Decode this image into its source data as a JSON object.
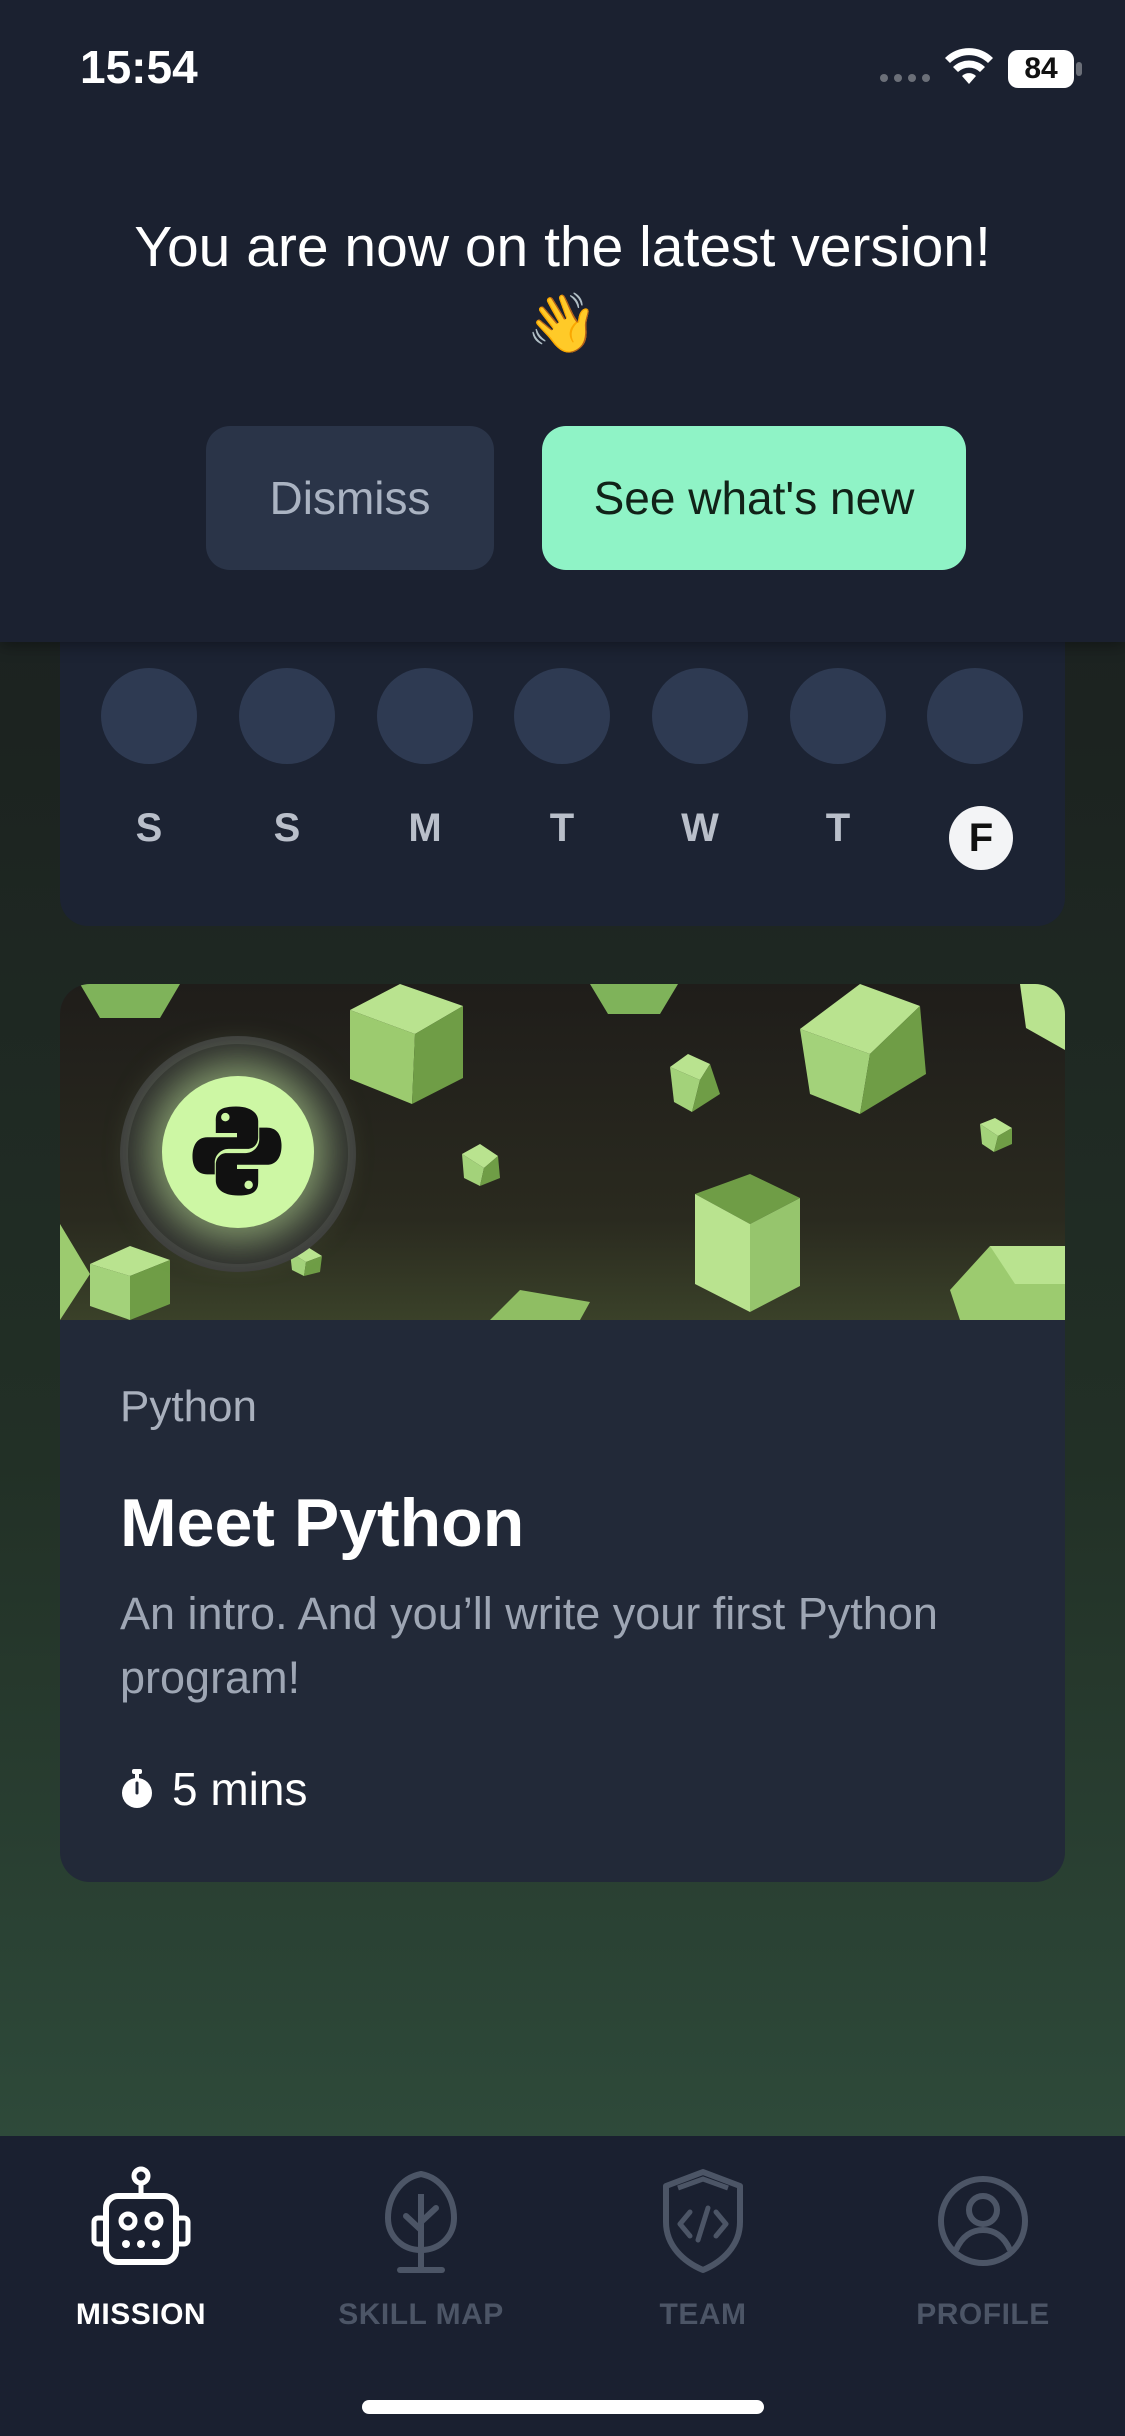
{
  "status": {
    "time": "15:54",
    "battery": "84"
  },
  "banner": {
    "title": "You are now on the latest version!",
    "emoji": "👋",
    "dismiss_label": "Dismiss",
    "new_label": "See what's new"
  },
  "streak": {
    "days": [
      "S",
      "S",
      "M",
      "T",
      "W",
      "T",
      "F"
    ],
    "today_index": 6
  },
  "lesson": {
    "category": "Python",
    "title": "Meet Python",
    "description": "An intro. And you’ll write your first Python program!",
    "duration": "5 mins",
    "accent_color": "#cdf7a4"
  },
  "nav": {
    "items": [
      {
        "label": "MISSION",
        "icon": "robot-icon",
        "active": true
      },
      {
        "label": "SKILL MAP",
        "icon": "tree-icon",
        "active": false
      },
      {
        "label": "TEAM",
        "icon": "code-shield-icon",
        "active": false
      },
      {
        "label": "PROFILE",
        "icon": "profile-icon",
        "active": false
      }
    ]
  }
}
